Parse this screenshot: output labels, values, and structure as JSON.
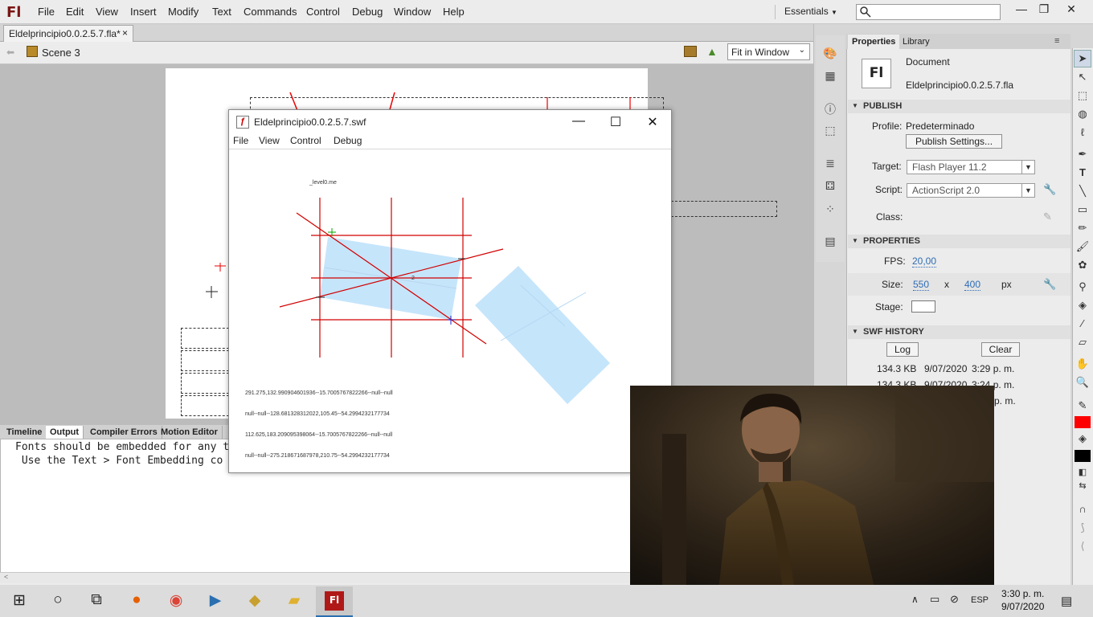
{
  "app": {
    "logo": "Fl"
  },
  "menu": [
    "File",
    "Edit",
    "View",
    "Insert",
    "Modify",
    "Text",
    "Commands",
    "Control",
    "Debug",
    "Window",
    "Help"
  ],
  "workspace": {
    "label": "Essentials"
  },
  "doc_tab": {
    "label": "Eldelprincipio0.0.2.5.7.fla*",
    "close": "×"
  },
  "scene": {
    "label": "Scene 3"
  },
  "zoom": {
    "value": "Fit in Window"
  },
  "properties": {
    "tabs": [
      "Properties",
      "Library"
    ],
    "doc_type": "Document",
    "doc_icon": "Fl",
    "file_name": "Eldelprincipio0.0.2.5.7.fla",
    "publish_header": "PUBLISH",
    "profile_label": "Profile:",
    "profile_value": "Predeterminado",
    "publish_settings": "Publish Settings...",
    "target_label": "Target:",
    "target_value": "Flash Player 11.2",
    "script_label": "Script:",
    "script_value": "ActionScript 2.0",
    "class_label": "Class:",
    "properties_header": "PROPERTIES",
    "fps_label": "FPS:",
    "fps_value": "20,00",
    "size_label": "Size:",
    "width": "550",
    "x": "x",
    "height": "400",
    "px": "px",
    "stage_label": "Stage:",
    "stage_color": "#ffffff",
    "history_header": "SWF HISTORY",
    "log": "Log",
    "clear": "Clear",
    "history": [
      {
        "size": "134.3 KB",
        "date": "9/07/2020",
        "time": "3:29 p. m."
      },
      {
        "size": "134.3 KB",
        "date": "9/07/2020",
        "time": "3:24 p. m."
      },
      {
        "size": "",
        "date": "",
        "time": "p. m."
      }
    ]
  },
  "bottom": {
    "tabs": [
      "Timeline",
      "Output",
      "Compiler Errors",
      "Motion Editor"
    ],
    "output_lines": [
      "Fonts should be embedded for any t",
      " Use the Text > Font Embedding co"
    ]
  },
  "swf_window": {
    "title": "Eldelprincipio0.0.2.5.7.swf",
    "menu": [
      "File",
      "View",
      "Control",
      "Debug"
    ],
    "level_label": "_level0.me",
    "point_label": "2",
    "trace": [
      "291.275,132.990904601936--15.7005767822266--null--null",
      "null--null--128.681328312022,105.45--54.2994232177734",
      "112.625,183.209095398064--15.7005767822266--null--null",
      "null--null--275.218671687978,210.75--54.2994232177734"
    ]
  },
  "taskbar": {
    "lang": "ESP",
    "time": "3:30 p. m.",
    "date": "9/07/2020"
  },
  "colors": {
    "accent_red": "#ff0000",
    "shape_fill": "#c5e5fb"
  }
}
